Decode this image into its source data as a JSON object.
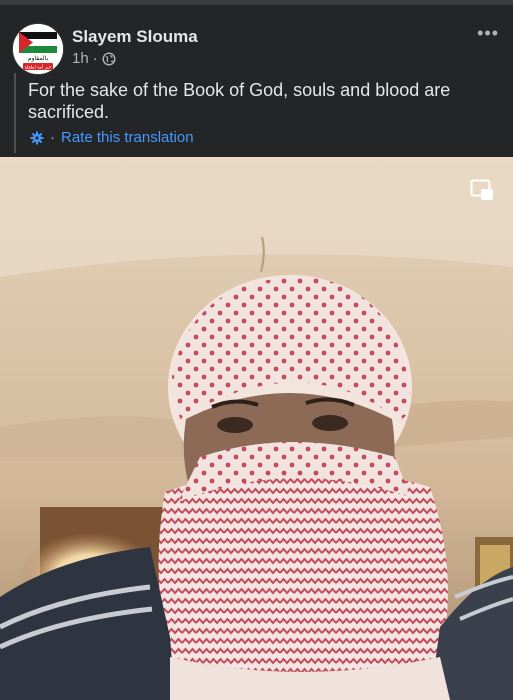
{
  "post": {
    "author": "Slayem Slouma",
    "time": "1h",
    "separator": "·",
    "avatar_text": "بالمقاوم",
    "avatar_text_2": "خير أمة لطفلة",
    "more_label": "•••",
    "translated_text": "For the sake of the Book of God, souls and blood are sacrificed.",
    "rate_separator": "·",
    "rate_translation_label": "Rate this translation"
  },
  "colors": {
    "background": "#242526",
    "text_primary": "#e4e6eb",
    "text_secondary": "#b0b3b8",
    "link_blue": "#4599ff"
  },
  "icons": {
    "privacy": "globe-icon",
    "settings": "gear-icon",
    "more": "more-options-icon",
    "pip": "picture-in-picture-icon"
  }
}
